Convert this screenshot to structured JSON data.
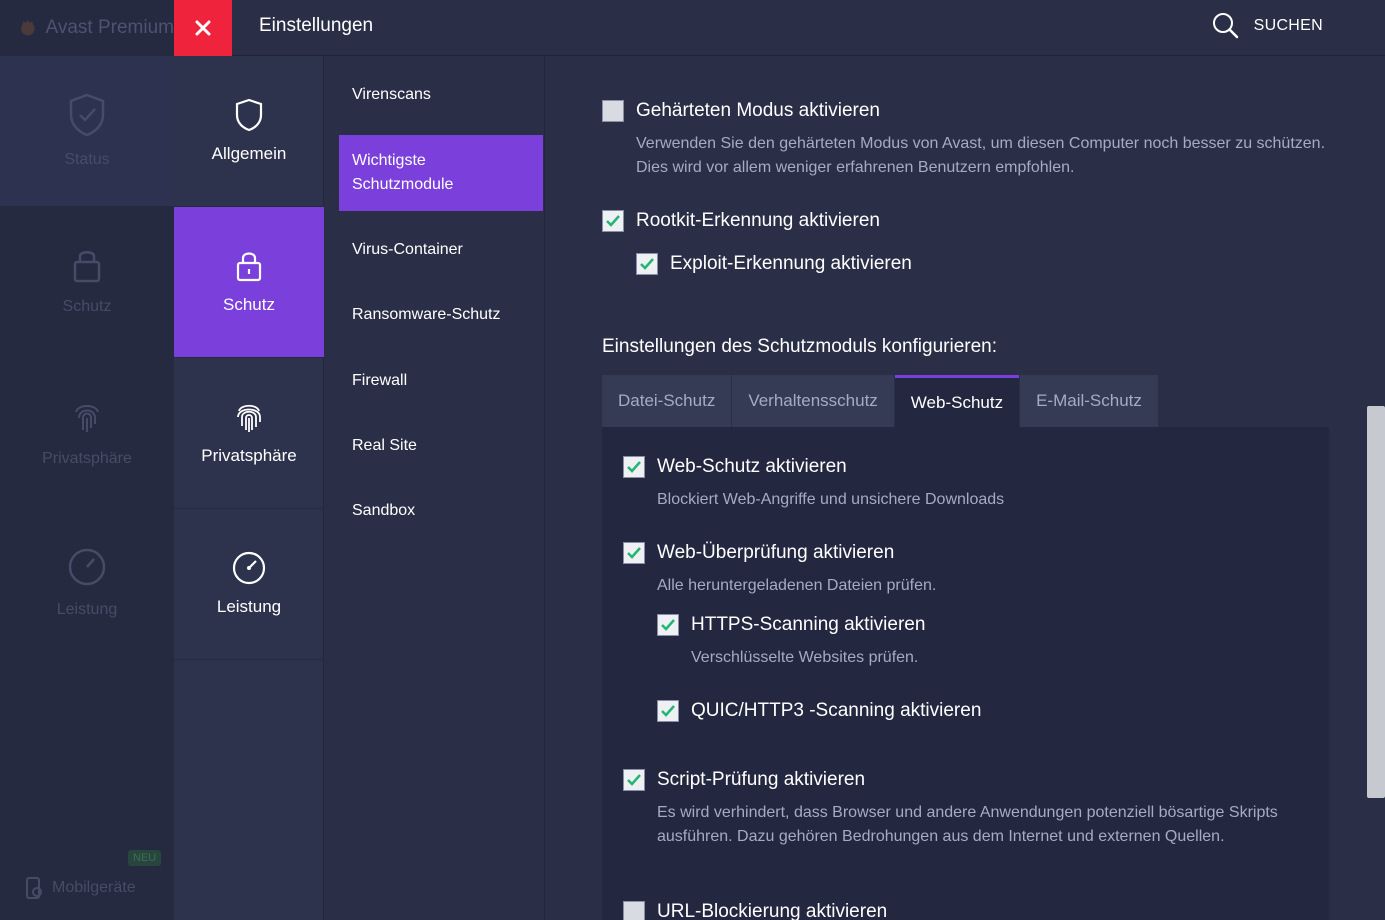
{
  "background_app": {
    "brand": "Avast Premium",
    "items": [
      "Status",
      "Schutz",
      "Privatsphäre",
      "Leistung"
    ],
    "mobile": "Mobilgeräte",
    "new_badge": "NEU"
  },
  "header": {
    "title": "Einstellungen",
    "search_label": "SUCHEN"
  },
  "categories": [
    {
      "label": "Allgemein",
      "icon": "shield-icon"
    },
    {
      "label": "Schutz",
      "icon": "lock-icon",
      "active": true
    },
    {
      "label": "Privatsphäre",
      "icon": "fingerprint-icon"
    },
    {
      "label": "Leistung",
      "icon": "speedometer-icon"
    }
  ],
  "submenu": [
    {
      "label": "Virenscans"
    },
    {
      "label": "Wichtigste Schutzmodule",
      "active": true
    },
    {
      "label": "Virus-Container"
    },
    {
      "label": "Ransomware-Schutz"
    },
    {
      "label": "Firewall"
    },
    {
      "label": "Real Site"
    },
    {
      "label": "Sandbox"
    }
  ],
  "content": {
    "hardened": {
      "label": "Gehärteten Modus aktivieren",
      "checked": false,
      "desc": "Verwenden Sie den gehärteten Modus von Avast, um diesen Computer noch besser zu schützen. Dies wird vor allem weniger erfahrenen Benutzern empfohlen."
    },
    "rootkit": {
      "label": "Rootkit-Erkennung aktivieren",
      "checked": true
    },
    "exploit": {
      "label": "Exploit-Erkennung aktivieren",
      "checked": true
    },
    "section_title": "Einstellungen des Schutzmoduls konfigurieren:",
    "tabs": [
      {
        "label": "Datei-Schutz"
      },
      {
        "label": "Verhaltensschutz"
      },
      {
        "label": "Web-Schutz",
        "active": true
      },
      {
        "label": "E-Mail-Schutz"
      }
    ],
    "web": {
      "enable": {
        "label": "Web-Schutz aktivieren",
        "checked": true,
        "desc": "Blockiert Web-Angriffe und unsichere Downloads"
      },
      "check": {
        "label": "Web-Überprüfung aktivieren",
        "checked": true,
        "desc": "Alle heruntergeladenen Dateien prüfen."
      },
      "https": {
        "label": "HTTPS-Scanning aktivieren",
        "checked": true,
        "desc": "Verschlüsselte Websites prüfen."
      },
      "quic": {
        "label": "QUIC/HTTP3 -Scanning aktivieren",
        "checked": true
      },
      "script": {
        "label": "Script-Prüfung aktivieren",
        "checked": true,
        "desc": "Es wird verhindert, dass Browser und andere Anwendungen potenziell bösartige Skripts ausführen. Dazu gehören Bedrohungen aus dem Internet und externen Quellen."
      },
      "url": {
        "label": "URL-Blockierung aktivieren",
        "checked": false
      }
    }
  },
  "colors": {
    "accent": "#7b3fdc",
    "close": "#ef233c",
    "check": "#22b573",
    "background": "#2a2f47"
  }
}
